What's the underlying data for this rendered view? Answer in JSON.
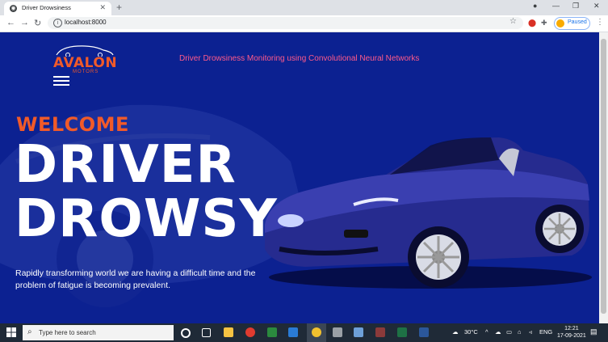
{
  "browser": {
    "tab_title": "Driver Drowsiness",
    "url": "localhost:8000",
    "profile_label": "Paused"
  },
  "page": {
    "logo_text": "AVALON",
    "logo_subtext": "MOTORS",
    "header_title": "Driver Drowsiness Monitoring using Convolutional Neural Networks",
    "welcome": "WELCOME",
    "hero_line1": "DRIVER",
    "hero_line2": "DROWSY",
    "description": "Rapidly transforming world we are having a difficult time and the problem of fatigue is becoming prevalent."
  },
  "taskbar": {
    "search_placeholder": "Type here to search",
    "temperature": "30°C",
    "language": "ENG",
    "time": "12:21",
    "date": "17-09-2021"
  },
  "colors": {
    "page_bg": "#0c2191",
    "accent_orange": "#f15a29",
    "header_pink": "#ff5a8a"
  }
}
